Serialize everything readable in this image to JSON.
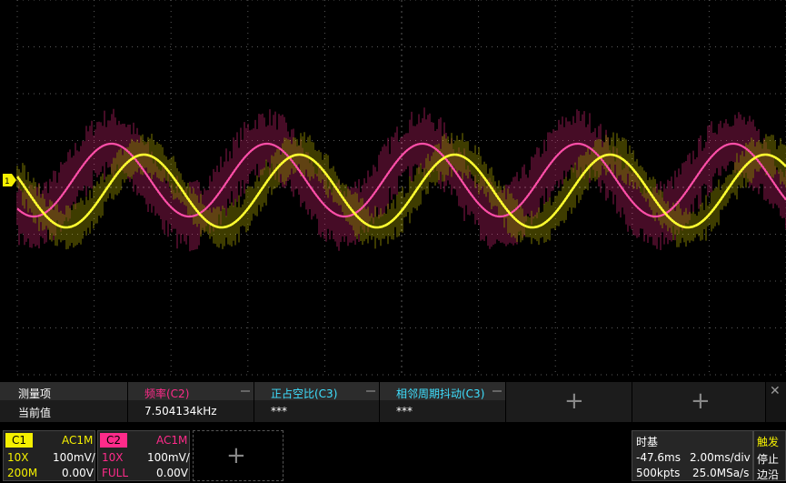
{
  "measurement": {
    "row_header": "测量项",
    "row_value": "当前值",
    "items": [
      {
        "name": "频率(C2)",
        "value": "7.504134kHz",
        "color": "#ff2b8a"
      },
      {
        "name": "正占空比(C3)",
        "value": "***",
        "color": "#3fe0ff"
      },
      {
        "name": "相邻周期抖动(C3)",
        "value": "***",
        "color": "#3fe0ff"
      }
    ],
    "close_glyph": "✕"
  },
  "channel1": {
    "tag": "C1",
    "coupling": "AC1M",
    "probe": "10X",
    "scale": "100mV/",
    "bandwidth": "200M",
    "offset": "0.00V",
    "color": "#f5f000"
  },
  "channel2": {
    "tag": "C2",
    "coupling": "AC1M",
    "probe": "10X",
    "scale": "100mV/",
    "bandwidth": "FULL",
    "offset": "0.00V",
    "color": "#ff2b8a"
  },
  "timebase": {
    "title": "时基",
    "delay": "-47.6ms",
    "scale": "2.00ms/div",
    "memory": "500kpts",
    "sample_rate": "25.0MSa/s"
  },
  "trigger": {
    "title": "触发",
    "state": "停止",
    "edge": "边沿"
  },
  "channel1_marker": "1",
  "waveform_legend": {
    "c1_color": "#f5f000",
    "c2_color": "#ff2b8a"
  }
}
